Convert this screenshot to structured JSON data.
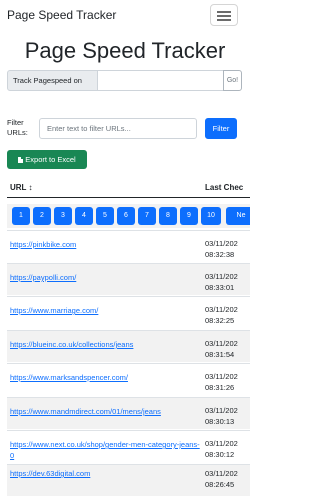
{
  "navbar": {
    "brand": "Page Speed Tracker"
  },
  "header": {
    "title": "Page Speed Tracker"
  },
  "track": {
    "label": "Track Pagespeed on",
    "value": "",
    "go_label": "Go!"
  },
  "filter": {
    "label": "Filter URLs:",
    "placeholder": "Enter text to filter URLs...",
    "button_label": "Filter"
  },
  "export": {
    "label": "Export to Excel",
    "icon": "file-excel-icon"
  },
  "table": {
    "headers": {
      "url": "URL ↕",
      "last_checked": "Last Chec"
    },
    "pages": [
      "1",
      "2",
      "3",
      "4",
      "5",
      "6",
      "7",
      "8",
      "9",
      "10",
      "Ne"
    ],
    "rows": [
      {
        "url": "https://pinkbike.com",
        "date": "03/11/202",
        "time": "08:32:38"
      },
      {
        "url": "https://paypolli.com/",
        "date": "03/11/202",
        "time": "08:33:01"
      },
      {
        "url": "https://www.marriage.com/",
        "date": "03/11/202",
        "time": "08:32:25"
      },
      {
        "url": "https://blueinc.co.uk/collections/jeans",
        "date": "03/11/202",
        "time": "08:31:54"
      },
      {
        "url": "https://www.marksandspencer.com/",
        "date": "03/11/202",
        "time": "08:31:26"
      },
      {
        "url": "https://www.mandmdirect.com/01/mens/jeans",
        "date": "03/11/202",
        "time": "08:30:13"
      },
      {
        "url": "https://www.next.co.uk/shop/gender-men-category-jeans-0",
        "date": "03/11/202",
        "time": "08:30:12"
      },
      {
        "url": "https://dev.63digital.com",
        "date": "03/11/202",
        "time": "08:26:45"
      }
    ]
  }
}
